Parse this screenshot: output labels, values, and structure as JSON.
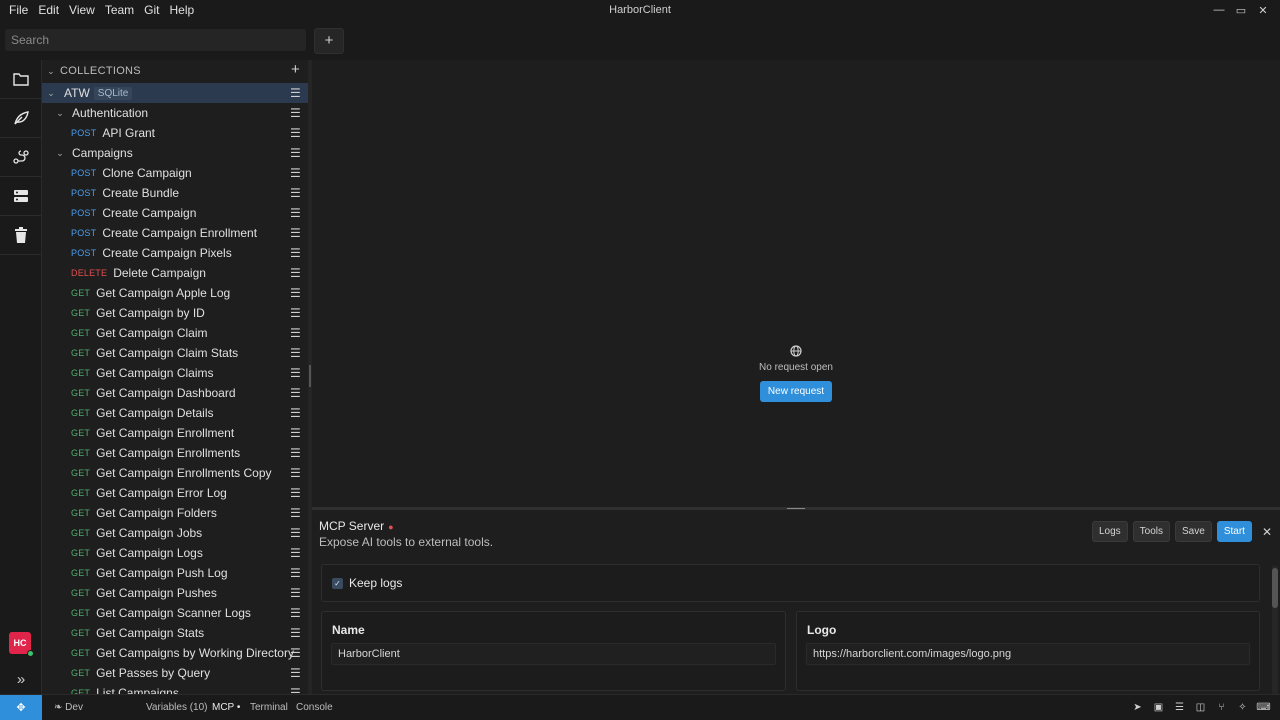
{
  "window": {
    "title": "HarborClient",
    "menu": [
      "File",
      "Edit",
      "View",
      "Team",
      "Git",
      "Help"
    ],
    "controls": [
      "—",
      "▭",
      "✕"
    ]
  },
  "toolbar": {
    "search_placeholder": "Search",
    "add_tab_label": "+"
  },
  "rail": {
    "avatar_initials": "HC",
    "expand_label": "»"
  },
  "sidebar": {
    "header": "COLLECTIONS",
    "add_label": "+",
    "collection": {
      "name": "ATW",
      "badge": "SQLite"
    },
    "rows": [
      {
        "kind": "folder",
        "label": "Authentication"
      },
      {
        "kind": "request",
        "method": "POST",
        "label": "API Grant"
      },
      {
        "kind": "folder",
        "label": "Campaigns"
      },
      {
        "kind": "request",
        "method": "POST",
        "label": "Clone Campaign"
      },
      {
        "kind": "request",
        "method": "POST",
        "label": "Create Bundle"
      },
      {
        "kind": "request",
        "method": "POST",
        "label": "Create Campaign"
      },
      {
        "kind": "request",
        "method": "POST",
        "label": "Create Campaign Enrollment"
      },
      {
        "kind": "request",
        "method": "POST",
        "label": "Create Campaign Pixels"
      },
      {
        "kind": "request",
        "method": "DELETE",
        "label": "Delete Campaign"
      },
      {
        "kind": "request",
        "method": "GET",
        "label": "Get Campaign Apple Log"
      },
      {
        "kind": "request",
        "method": "GET",
        "label": "Get Campaign by ID"
      },
      {
        "kind": "request",
        "method": "GET",
        "label": "Get Campaign Claim"
      },
      {
        "kind": "request",
        "method": "GET",
        "label": "Get Campaign Claim Stats"
      },
      {
        "kind": "request",
        "method": "GET",
        "label": "Get Campaign Claims"
      },
      {
        "kind": "request",
        "method": "GET",
        "label": "Get Campaign Dashboard"
      },
      {
        "kind": "request",
        "method": "GET",
        "label": "Get Campaign Details"
      },
      {
        "kind": "request",
        "method": "GET",
        "label": "Get Campaign Enrollment"
      },
      {
        "kind": "request",
        "method": "GET",
        "label": "Get Campaign Enrollments"
      },
      {
        "kind": "request",
        "method": "GET",
        "label": "Get Campaign Enrollments Copy"
      },
      {
        "kind": "request",
        "method": "GET",
        "label": "Get Campaign Error Log"
      },
      {
        "kind": "request",
        "method": "GET",
        "label": "Get Campaign Folders"
      },
      {
        "kind": "request",
        "method": "GET",
        "label": "Get Campaign Jobs"
      },
      {
        "kind": "request",
        "method": "GET",
        "label": "Get Campaign Logs"
      },
      {
        "kind": "request",
        "method": "GET",
        "label": "Get Campaign Push Log"
      },
      {
        "kind": "request",
        "method": "GET",
        "label": "Get Campaign Pushes"
      },
      {
        "kind": "request",
        "method": "GET",
        "label": "Get Campaign Scanner Logs"
      },
      {
        "kind": "request",
        "method": "GET",
        "label": "Get Campaign Stats"
      },
      {
        "kind": "request",
        "method": "GET",
        "label": "Get Campaigns by Working Directory"
      },
      {
        "kind": "request",
        "method": "GET",
        "label": "Get Passes by Query"
      },
      {
        "kind": "request",
        "method": "GET",
        "label": "List Campaigns"
      }
    ]
  },
  "main": {
    "empty_text": "No request open",
    "new_request_label": "New request"
  },
  "panel": {
    "title": "MCP Server",
    "subtitle": "Expose AI tools to external tools.",
    "buttons": {
      "logs": "Logs",
      "tools": "Tools",
      "save": "Save",
      "start": "Start"
    },
    "keep_logs_label": "Keep logs",
    "name_label": "Name",
    "name_value": "HarborClient",
    "logo_label": "Logo",
    "logo_value": "https://harborclient.com/images/logo.png"
  },
  "statusbar": {
    "env": "Dev",
    "variables": "Variables (10)",
    "mcp": "MCP •",
    "terminal": "Terminal",
    "console": "Console"
  },
  "colors": {
    "accent": "#2f8fdb",
    "post": "#4a9df0",
    "get": "#4caf6a",
    "delete": "#e05050",
    "avatar": "#e0244a"
  }
}
